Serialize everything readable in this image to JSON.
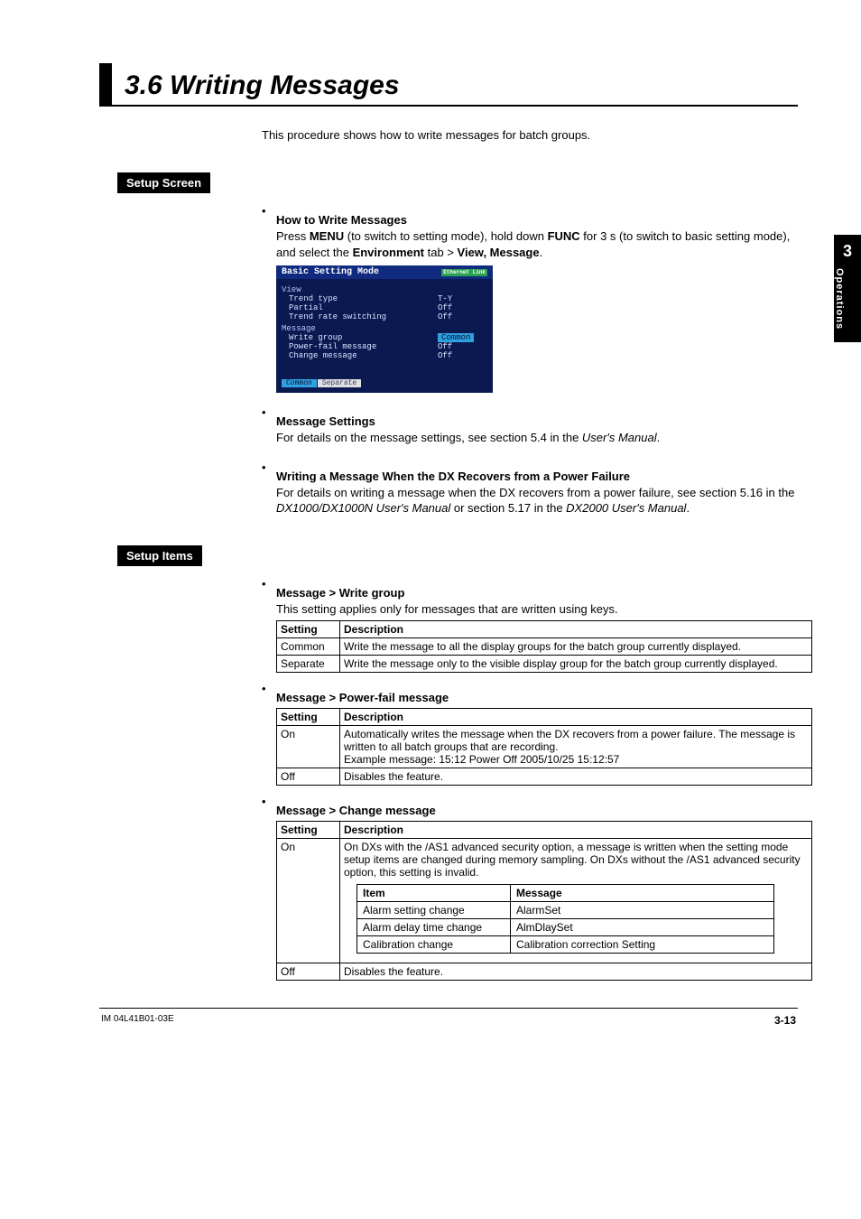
{
  "side_tab": {
    "num": "3",
    "label": "Operations"
  },
  "title": "3.6   Writing Messages",
  "intro": "This procedure shows how to write messages for batch groups.",
  "setup_screen_label": "Setup Screen",
  "setup_items_label": "Setup Items",
  "how_to_heading": "How to Write Messages",
  "how_to_prefix": "Press ",
  "how_to_menu": "MENU",
  "how_to_mid1": " (to switch to setting mode), hold down ",
  "how_to_func": "FUNC",
  "how_to_mid2": " for 3 s (to switch to basic setting mode), and select the ",
  "how_to_env": "Environment",
  "how_to_mid3": " tab > ",
  "how_to_view": "View, Message",
  "how_to_end": ".",
  "device": {
    "title": "Basic Setting Mode",
    "badge": "Ethernet\nLink",
    "group_view": "View",
    "view_rows": [
      {
        "lbl": "Trend type",
        "val": "T-Y"
      },
      {
        "lbl": "Partial",
        "val": "Off"
      },
      {
        "lbl": "Trend rate switching",
        "val": "Off"
      }
    ],
    "group_msg": "Message",
    "msg_rows": [
      {
        "lbl": "Write group",
        "val": "Common",
        "hl": true
      },
      {
        "lbl": "Power-fail message",
        "val": "Off"
      },
      {
        "lbl": "Change message",
        "val": "Off"
      }
    ],
    "opts": [
      "Common",
      "Separate"
    ]
  },
  "msg_settings_heading": "Message Settings",
  "msg_settings_text1": "For details on the message settings, see section 5.4 in the ",
  "msg_settings_manual": "User's Manual",
  "writing_pf_heading": "Writing a Message When the DX Recovers from a Power Failure",
  "writing_pf_text1": "For details on writing a message when the DX recovers from a power failure, see section 5.16 in the ",
  "writing_pf_manual1": "DX1000/DX1000N User's Manual",
  "writing_pf_mid": " or section 5.17 in the ",
  "writing_pf_manual2": "DX2000 User's Manual",
  "wg_heading": "Message > Write group",
  "wg_note": "This setting applies only for messages that are written using keys.",
  "th_setting": "Setting",
  "th_desc": "Description",
  "wg_rows": [
    {
      "s": "Common",
      "d": "Write the message to all the display groups for the batch group currently displayed."
    },
    {
      "s": "Separate",
      "d": "Write the message only to the visible display group for the batch group currently displayed."
    }
  ],
  "pf_heading": "Message > Power-fail message",
  "pf_rows": [
    {
      "s": "On",
      "d": "Automatically writes the message when the DX recovers from a power failure. The message is written to all batch groups that are recording.\nExample message: 15:12 Power Off 2005/10/25 15:12:57"
    },
    {
      "s": "Off",
      "d": "Disables the feature."
    }
  ],
  "cm_heading": "Message > Change message",
  "cm_on_setting": "On",
  "cm_on_desc": "On DXs with the /AS1 advanced security option, a message is written when the setting mode setup items are changed during memory sampling. On DXs without the /AS1 advanced security option, this setting is invalid.",
  "cm_inner_th_item": "Item",
  "cm_inner_th_msg": "Message",
  "cm_inner_rows": [
    {
      "i": "Alarm setting change",
      "m": "AlarmSet"
    },
    {
      "i": "Alarm delay time change",
      "m": "AlmDlaySet"
    },
    {
      "i": "Calibration change",
      "m": "Calibration correction Setting"
    }
  ],
  "cm_off_setting": "Off",
  "cm_off_desc": "Disables the feature.",
  "footer_left": "IM 04L41B01-03E",
  "footer_right": "3-13"
}
